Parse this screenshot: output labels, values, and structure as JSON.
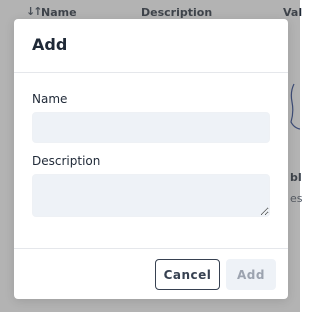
{
  "background": {
    "table_headers": [
      "Name",
      "Description",
      "Val"
    ],
    "sort_icon": "sort-arrows-icon",
    "empty_state_title_fragment": "bl",
    "empty_state_subtitle_fragment": "es"
  },
  "modal": {
    "title": "Add",
    "fields": {
      "name": {
        "label": "Name",
        "value": "",
        "placeholder": ""
      },
      "description": {
        "label": "Description",
        "value": "",
        "placeholder": ""
      }
    },
    "buttons": {
      "cancel": "Cancel",
      "add": "Add"
    }
  },
  "colors": {
    "overlay": "#606060",
    "input_background": "#eef2f7",
    "primary_text": "#1f2937",
    "disabled_text": "#9ca3af"
  }
}
